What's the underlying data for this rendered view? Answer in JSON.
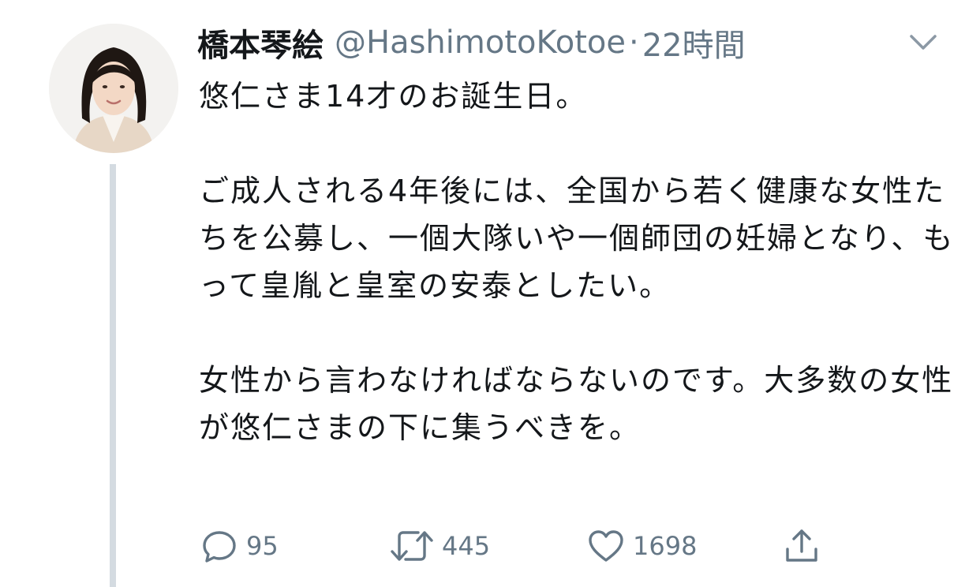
{
  "tweet": {
    "display_name": "橋本琴絵",
    "handle": "@HashimotoKotoe",
    "separator": "·",
    "time": "22時間",
    "paragraphs": [
      "悠仁さま14才のお誕生日。",
      "ご成人される4年後には、全国から若く健康な女性たちを公募し、一個大隊いや一個師団の妊婦となり、もって皇胤と皇室の安泰としたい。",
      "女性から言わなければならないのです。大多数の女性が悠仁さまの下に集うべきを。"
    ],
    "actions": {
      "reply_count": "95",
      "retweet_count": "445",
      "like_count": "1698"
    }
  },
  "icons": {
    "avatar": "avatar",
    "caret": "chevron-down-icon",
    "reply": "reply-icon",
    "retweet": "retweet-icon",
    "like": "heart-icon",
    "share": "share-icon"
  },
  "colors": {
    "text_primary": "#14171a",
    "text_secondary": "#657786",
    "thread_line": "#d4dbe1",
    "background": "#ffffff"
  }
}
